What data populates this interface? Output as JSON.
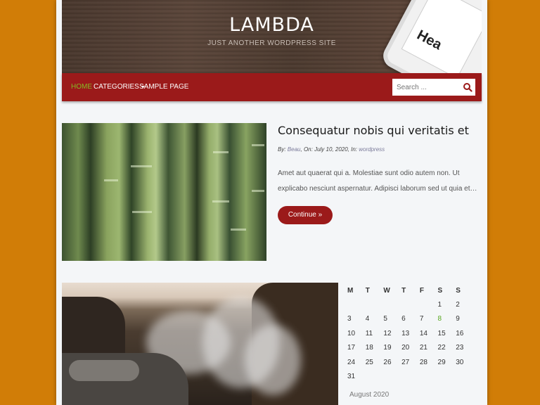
{
  "site": {
    "title": "LAMBDA",
    "tagline": "JUST ANOTHER WORDPRESS SITE",
    "phone_text": "Hea"
  },
  "nav": {
    "items": [
      "HOME",
      "CATEGORIES",
      "SAMPLE PAGE"
    ],
    "search_placeholder": "Search ...",
    "colors": {
      "bar": "#9b1a1a",
      "active": "#86b924"
    }
  },
  "post1": {
    "title": "Consequatur nobis qui veritatis et",
    "meta_by_label": "By:",
    "author": "Beau",
    "meta_on_label": "On:",
    "date": "July 10, 2020",
    "meta_in_label": "In:",
    "category": "wordpress",
    "excerpt": "Amet aut quaerat qui a. Molestiae sunt odio autem non. Ut explicabo nesciunt aspernatur. Adipisci laborum sed ut quia et…",
    "continue_label": "Continue »"
  },
  "calendar": {
    "caption": "August 2020",
    "weekdays": [
      "M",
      "T",
      "W",
      "T",
      "F",
      "S",
      "S"
    ],
    "weeks": [
      [
        "",
        "",
        "",
        "",
        "",
        "1",
        "2"
      ],
      [
        "3",
        "4",
        "5",
        "6",
        "7",
        "8",
        "9"
      ],
      [
        "10",
        "11",
        "12",
        "13",
        "14",
        "15",
        "16"
      ],
      [
        "17",
        "18",
        "19",
        "20",
        "21",
        "22",
        "23"
      ],
      [
        "24",
        "25",
        "26",
        "27",
        "28",
        "29",
        "30"
      ],
      [
        "31",
        "",
        "",
        "",
        "",
        "",
        ""
      ]
    ],
    "highlighted_day": "8",
    "highlight_color": "#58a61e"
  },
  "background_color": "#d17d07"
}
